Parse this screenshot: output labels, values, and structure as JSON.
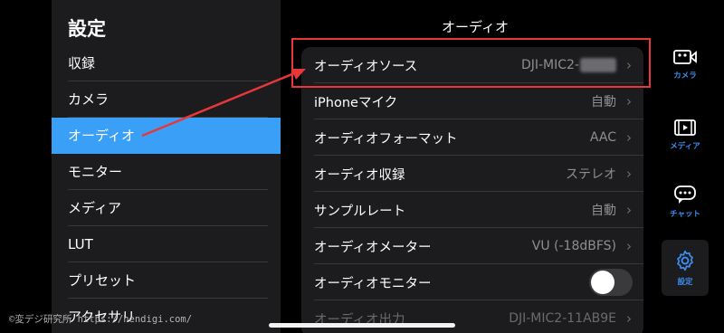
{
  "left": {
    "title": "設定",
    "items": [
      {
        "label": "収録"
      },
      {
        "label": "カメラ"
      },
      {
        "label": "オーディオ",
        "active": true
      },
      {
        "label": "モニター"
      },
      {
        "label": "メディア"
      },
      {
        "label": "LUT"
      },
      {
        "label": "プリセット"
      },
      {
        "label": "アクセサリ"
      }
    ]
  },
  "main": {
    "title": "オーディオ",
    "rows": [
      {
        "label": "オーディオソース",
        "value": "DJI-MIC2-"
      },
      {
        "label": "iPhoneマイク",
        "value": "自動"
      },
      {
        "label": "オーディオフォーマット",
        "value": "AAC"
      },
      {
        "label": "オーディオ収録",
        "value": "ステレオ"
      },
      {
        "label": "サンプルレート",
        "value": "自動"
      },
      {
        "label": "オーディオメーター",
        "value": "VU (-18dBFS)"
      },
      {
        "label": "オーディオモニター",
        "toggle": false
      },
      {
        "label": "オーディオ出力",
        "value": "DJI-MIC2-11AB9E"
      }
    ]
  },
  "tabs": [
    {
      "label": "カメラ",
      "icon": "camera-icon"
    },
    {
      "label": "メディア",
      "icon": "film-icon"
    },
    {
      "label": "チャット",
      "icon": "chat-icon"
    },
    {
      "label": "設定",
      "icon": "gear-icon",
      "active": true
    }
  ],
  "watermark": "©変デジ研究所 https://hendigi.com/",
  "colors": {
    "accent": "#3aa0f7",
    "highlight": "#e8373a",
    "tab_icon": "#3a8df0"
  }
}
